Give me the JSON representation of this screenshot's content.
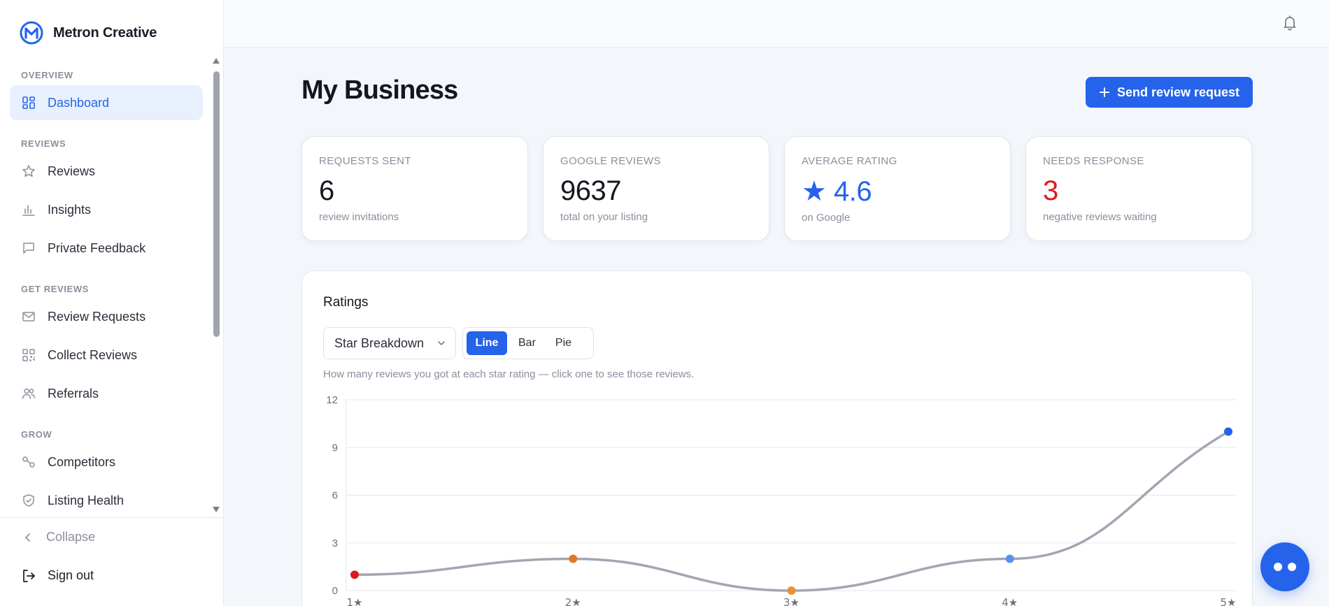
{
  "brand": {
    "name": "Metron Creative"
  },
  "sidebar": {
    "sections": [
      {
        "title": "OVERVIEW",
        "items": [
          {
            "label": "Dashboard",
            "icon": "grid-icon",
            "active": true
          }
        ]
      },
      {
        "title": "REVIEWS",
        "items": [
          {
            "label": "Reviews",
            "icon": "star-icon"
          },
          {
            "label": "Insights",
            "icon": "bar-chart-icon"
          },
          {
            "label": "Private Feedback",
            "icon": "message-icon"
          }
        ]
      },
      {
        "title": "GET REVIEWS",
        "items": [
          {
            "label": "Review Requests",
            "icon": "mail-icon"
          },
          {
            "label": "Collect Reviews",
            "icon": "qr-code-icon"
          },
          {
            "label": "Referrals",
            "icon": "users-icon"
          }
        ]
      },
      {
        "title": "GROW",
        "items": [
          {
            "label": "Competitors",
            "icon": "compare-icon"
          },
          {
            "label": "Listing Health",
            "icon": "shield-icon"
          }
        ]
      }
    ],
    "footer": {
      "collapse": "Collapse",
      "signout": "Sign out"
    }
  },
  "page": {
    "title": "My Business",
    "send_button": "Send review request"
  },
  "stats": [
    {
      "label": "REQUESTS SENT",
      "value": "6",
      "sub": "review invitations"
    },
    {
      "label": "GOOGLE REVIEWS",
      "value": "9637",
      "sub": "total on your listing"
    },
    {
      "label": "AVERAGE RATING",
      "value": "★ 4.6",
      "sub": "on Google"
    },
    {
      "label": "NEEDS RESPONSE",
      "value": "3",
      "sub": "negative reviews waiting"
    }
  ],
  "ratings": {
    "title": "Ratings",
    "select_value": "Star Breakdown",
    "chart_types": [
      "Line",
      "Bar",
      "Pie"
    ],
    "active_chart_type": "Line",
    "hint": "How many reviews you got at each star rating — click one to see those reviews."
  },
  "colors": {
    "accent": "#2563eb",
    "danger": "#dc1b1b",
    "point_colors": [
      "#dc1b1b",
      "#e07a2a",
      "#e8923a",
      "#5b8ff0",
      "#2563eb"
    ]
  },
  "chart_data": {
    "type": "line",
    "categories": [
      "1★",
      "2★",
      "3★",
      "4★",
      "5★"
    ],
    "values": [
      1,
      2,
      0,
      2,
      10
    ],
    "yticks": [
      0,
      3,
      6,
      9,
      12
    ],
    "ylim": [
      0,
      12
    ],
    "grid": true
  }
}
